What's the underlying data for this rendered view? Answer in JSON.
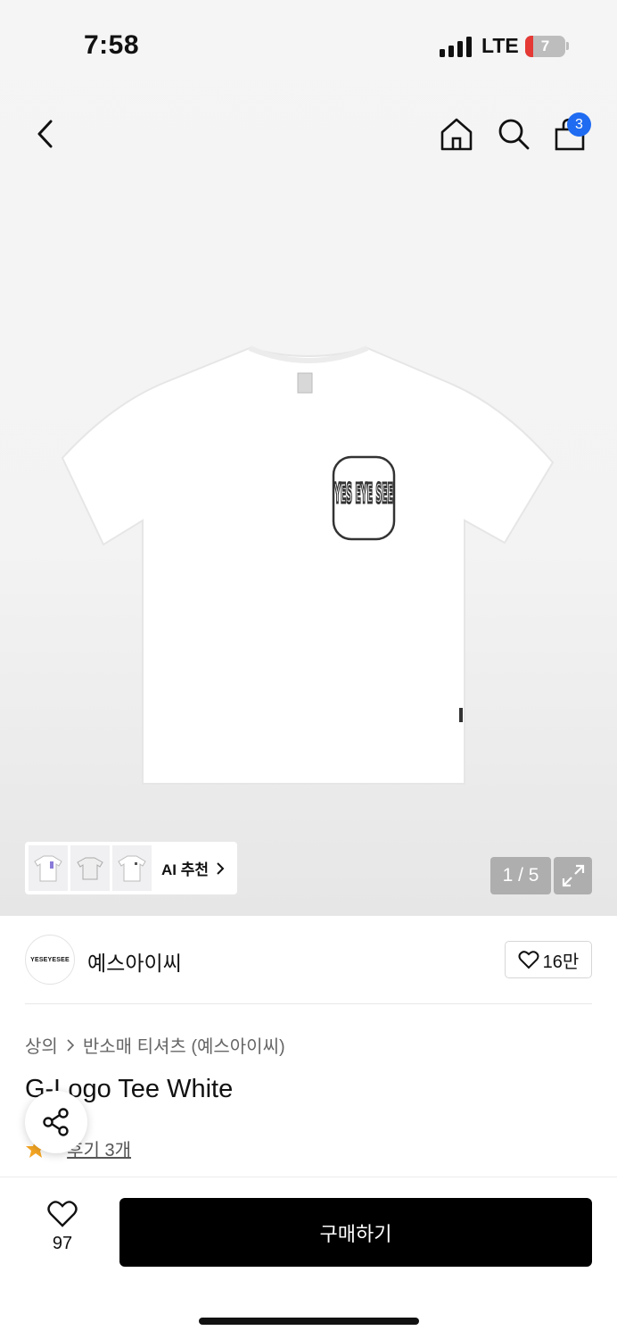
{
  "status": {
    "time": "7:58",
    "network": "LTE",
    "battery": "7"
  },
  "nav": {
    "cart_count": "3"
  },
  "gallery": {
    "reco_label": "AI 추천",
    "counter": "1 / 5",
    "print_text": "YES EYE SEE"
  },
  "brand": {
    "logo_text": "YESEYESEE",
    "name": "예스아이씨",
    "likes": "16만"
  },
  "product": {
    "breadcrumb": [
      "상의",
      "반소매 티셔츠 (예스아이씨)"
    ],
    "title": "G-Logo Tee White",
    "rating": "5",
    "reviews": "후기 3개"
  },
  "bottom_bar": {
    "wish_count": "97",
    "buy_label": "구매하기"
  },
  "colors": {
    "accent": "#1f6bf1",
    "star": "#f5a623",
    "buy_bg": "#000000"
  }
}
